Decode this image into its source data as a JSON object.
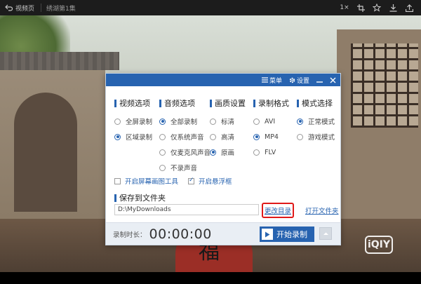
{
  "player": {
    "back_label": "视频页",
    "episode_title": "绣湖第1集",
    "speed_label": "1×"
  },
  "scene": {
    "logo_text": "iQIY",
    "shirt_char": "福"
  },
  "dialog": {
    "menu_label": "菜单",
    "settings_label": "设置",
    "columns": [
      {
        "title": "视频选项",
        "options": [
          "全屏录制",
          "区域录制"
        ],
        "selected": 1
      },
      {
        "title": "音频选项",
        "options": [
          "全部录制",
          "仅系统声音",
          "仅麦克风声音",
          "不录声音"
        ],
        "selected": 0
      },
      {
        "title": "画质设置",
        "options": [
          "标清",
          "高清",
          "原画"
        ],
        "selected": 2
      },
      {
        "title": "录制格式",
        "options": [
          "AVI",
          "MP4",
          "FLV"
        ],
        "selected": 1
      },
      {
        "title": "模式选择",
        "options": [
          "正常模式",
          "游戏模式"
        ],
        "selected": 0
      }
    ],
    "checkbox_screenshot": {
      "label": "开启屏幕画图工具",
      "checked": false
    },
    "checkbox_float": {
      "label": "开启悬浮框",
      "checked": true
    },
    "save_title": "保存到文件夹",
    "save_path": "D:\\MyDownloads",
    "change_dir_label": "更改目录",
    "open_folder_label": "打开文件夹",
    "duration_label": "录制时长：",
    "duration_value": "00:00:00",
    "start_label": "开始录制"
  },
  "colors": {
    "accent": "#2763b0",
    "highlight": "#e01919"
  }
}
